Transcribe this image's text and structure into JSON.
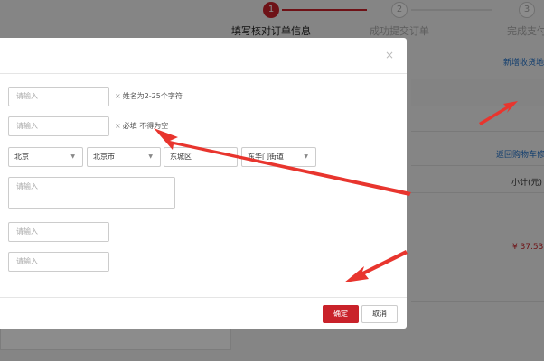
{
  "steps": [
    {
      "num": "1",
      "label": "填写核对订单信息"
    },
    {
      "num": "2",
      "label": "成功提交订单"
    },
    {
      "num": "3",
      "label": "完成支付"
    }
  ],
  "background": {
    "new_address_link": "新增收货地址",
    "back_to_cart_link": "返回购物车修改",
    "subtotal_header": "小计(元)",
    "price": "¥ 37.53"
  },
  "modal": {
    "name_input": {
      "placeholder": "请输入",
      "hint": "姓名为2-25个字符",
      "star": "×"
    },
    "phone_input": {
      "placeholder": "请输入",
      "hint": "必填 不得为空",
      "star": "×"
    },
    "region": {
      "province": "北京",
      "city": "北京市",
      "district": "东城区",
      "street": "东华门街道"
    },
    "address_textarea": {
      "placeholder": "请输入"
    },
    "field4": {
      "placeholder": "请输入"
    },
    "field5": {
      "placeholder": "请输入"
    },
    "confirm_label": "确定",
    "cancel_label": "取消",
    "close_glyph": "×"
  },
  "colors": {
    "accent": "#c9222a",
    "link": "#1e6fc8",
    "annotation_arrow": "#e8352e"
  }
}
